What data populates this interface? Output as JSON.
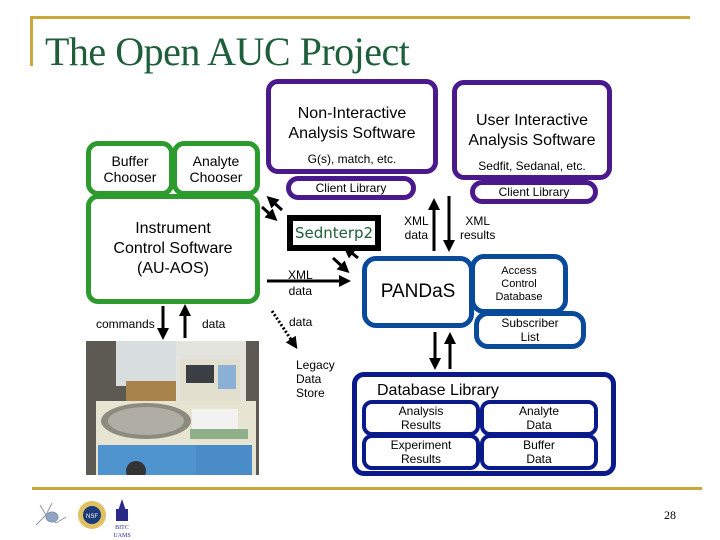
{
  "title": "The Open AUC Project",
  "page_number": "28",
  "colors": {
    "title": "#1e5e3a",
    "rule": "#c8a83a",
    "green_border": "#2d9a2d",
    "purple_border": "#4a1a8c",
    "blue_border": "#0a4a9a",
    "navy_border": "#0a1a8a"
  },
  "instrument": {
    "buffer_chooser": "Buffer Chooser",
    "analyte_chooser": "Analyte Chooser",
    "control_line1": "Instrument",
    "control_line2": "Control Software",
    "control_line3": "(AU-AOS)",
    "commands_label": "commands",
    "data_label": "data"
  },
  "non_interactive": {
    "title_line1": "Non-Interactive",
    "title_line2": "Analysis Software",
    "subtitle": "G(s), match, etc.",
    "client_library": "Client Library"
  },
  "user_interactive": {
    "title_line1": "User Interactive",
    "title_line2": "Analysis Software",
    "subtitle": "Sedfit, Sedanal, etc.",
    "client_library": "Client Library"
  },
  "sedinterp": "Sednterp2",
  "xml_data_left": {
    "line1": "XML",
    "line2": "data"
  },
  "xml_data_top": {
    "line1": "XML",
    "line2": "data"
  },
  "xml_results": {
    "line1": "XML",
    "line2": "results"
  },
  "legacy_data_label": "data",
  "legacy_store": {
    "line1": "Legacy",
    "line2": "Data",
    "line3": "Store"
  },
  "pandas": "PANDaS",
  "access_control": {
    "line1": "Access",
    "line2": "Control",
    "line3": "Database"
  },
  "subscriber": {
    "line1": "Subscriber",
    "line2": "List"
  },
  "database_library": {
    "title": "Database Library",
    "cells": [
      {
        "line1": "Analysis",
        "line2": "Results"
      },
      {
        "line1": "Analyte",
        "line2": "Data"
      },
      {
        "line1": "Experiment",
        "line2": "Results"
      },
      {
        "line1": "Buffer",
        "line2": "Data"
      }
    ]
  },
  "logos": [
    "molecule-logo",
    "nsf-logo",
    "bitc-uams-logo"
  ],
  "logo_text": {
    "bitc": "BITC",
    "uams": "UAMS"
  }
}
